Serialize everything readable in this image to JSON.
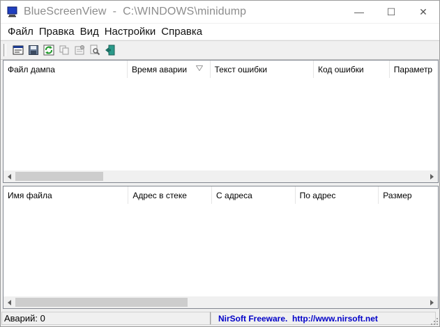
{
  "window": {
    "title": "BlueScreenView  -  C:\\WINDOWS\\minidump",
    "controls": {
      "minimize": "—",
      "maximize": "☐",
      "close": "✕"
    }
  },
  "menu": {
    "items": [
      "Файл",
      "Правка",
      "Вид",
      "Настройки",
      "Справка"
    ]
  },
  "toolbar": {
    "buttons": [
      "html-report-icon",
      "save-icon",
      "refresh-icon",
      "copy-icon",
      "properties-icon",
      "find-icon",
      "exit-icon"
    ]
  },
  "crash_list": {
    "columns": [
      "Файл дампа",
      "Время аварии",
      "Текст ошибки",
      "Код ошибки",
      "Параметр"
    ],
    "sorted_column": "Время аварии",
    "rows": []
  },
  "driver_list": {
    "columns": [
      "Имя файла",
      "Адрес в стеке",
      "С адреса",
      "По адрес",
      "Размер"
    ],
    "rows": []
  },
  "status": {
    "crash_count": "Аварий: 0",
    "credits": "NirSoft Freeware.  http://www.nirsoft.net"
  },
  "colors": {
    "credits_text": "#0000c8",
    "window_bg": "#f0f0f0"
  }
}
